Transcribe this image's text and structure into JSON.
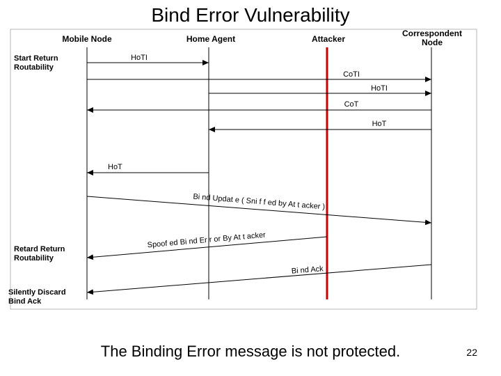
{
  "title": "Bind Error Vulnerability",
  "caption": "The Binding Error message is not protected.",
  "page_number": "22",
  "actors": {
    "mobile_node": "Mobile Node",
    "home_agent": "Home Agent",
    "attacker": "Attacker",
    "correspondent_node": "Correspondent\nNode"
  },
  "side_labels": {
    "start_rr": "Start Return\nRoutability",
    "retard_rr": "Retard Return\nRoutability",
    "discard_ack": "Silently Discard\nBind Ack"
  },
  "messages": {
    "hoti1": "HoTI",
    "coti1": "CoTI",
    "hoti2": "HoTI",
    "cot": "CoT",
    "hot1": "HoT",
    "hot2": "HoT",
    "bind_update": "Bi nd Updat e ( Sni f f ed by At t acker )",
    "spoofed_err": "Spoof ed Bi nd Er r or By At t acker",
    "bind_ack": "Bi nd Ack"
  },
  "colors": {
    "lifeline": "#000000",
    "attacker_line": "#cc0000"
  }
}
